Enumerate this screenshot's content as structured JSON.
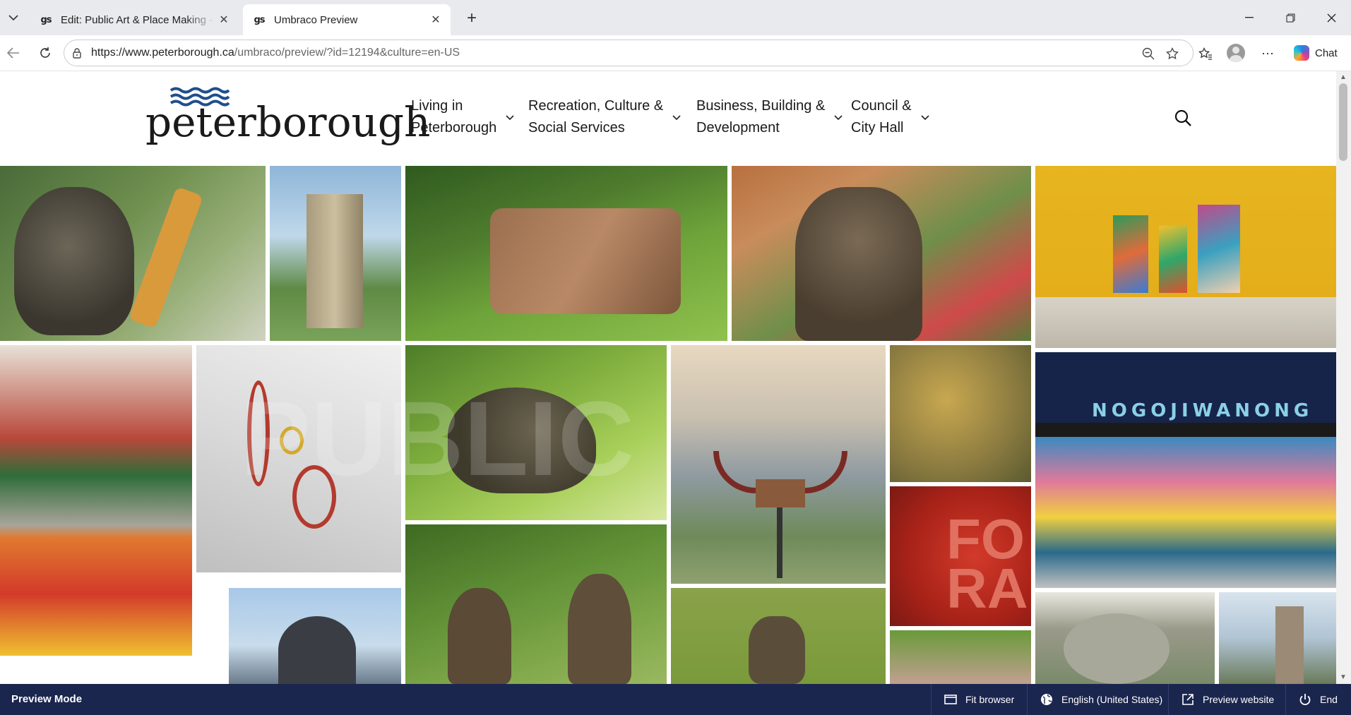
{
  "browser": {
    "tabs": [
      {
        "title": "Edit: Public Art & Place Making - Ci",
        "favicon": "gs-favicon",
        "active": false
      },
      {
        "title": "Umbraco Preview",
        "favicon": "gs-favicon",
        "active": true
      }
    ],
    "favicon_text": "gs",
    "url_host": "https://www.peterborough.ca",
    "url_path": "/umbraco/preview/?id=12194&culture=en-US",
    "chat_label": "Chat"
  },
  "site": {
    "logo_text": "peterborough",
    "nav": [
      {
        "line1": "Living in",
        "line2": "Peterborough"
      },
      {
        "line1": "Recreation, Culture &",
        "line2": "Social Services"
      },
      {
        "line1": "Business, Building &",
        "line2": "Development"
      },
      {
        "line1": "Council &",
        "line2": "City Hall"
      }
    ],
    "collage_sign_text": "NOGOJIWANONG"
  },
  "preview_bar": {
    "mode_label": "Preview Mode",
    "fit_browser": "Fit browser",
    "language": "English (United States)",
    "preview_website": "Preview website",
    "end": "End"
  },
  "colors": {
    "preview_bar": "#1b264f",
    "logo_waves": "#1f4e8c",
    "tab_strip": "#e8eaed"
  }
}
